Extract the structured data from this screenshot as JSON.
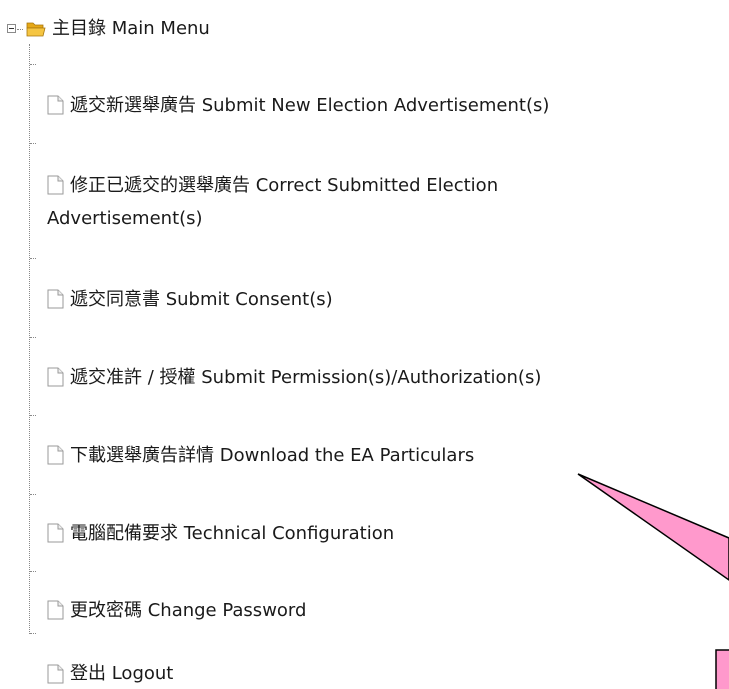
{
  "root": {
    "label": "主目錄 Main Menu"
  },
  "items": [
    {
      "label": "遞交新選舉廣告 Submit New Election Advertisement(s)",
      "label2": ""
    },
    {
      "label": "修正已遞交的選舉廣告 Correct Submitted Election",
      "label2": "Advertisement(s)"
    },
    {
      "label": "遞交同意書 Submit Consent(s)",
      "label2": ""
    },
    {
      "label": "遞交准許 / 授權 Submit Permission(s)/Authorization(s)",
      "label2": ""
    },
    {
      "label": "下載選舉廣告詳情 Download the EA Particulars",
      "label2": ""
    },
    {
      "label": "電腦配備要求 Technical Configuration",
      "label2": ""
    },
    {
      "label": "更改密碼 Change Password",
      "label2": ""
    },
    {
      "label": "登出 Logout",
      "label2": ""
    }
  ],
  "icons": {
    "root": "folder-open-icon",
    "item": "document-icon",
    "toggle": "collapse-icon"
  },
  "colors": {
    "folder": "#f5c542",
    "callout": "#ff99cc",
    "callout_border": "#000000"
  }
}
